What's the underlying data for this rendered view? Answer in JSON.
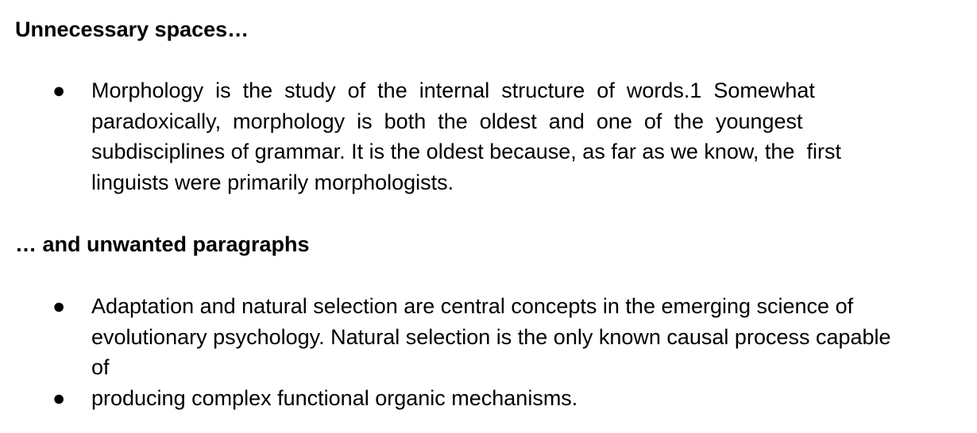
{
  "headings": {
    "spaces": "Unnecessary spaces…",
    "paragraphs": "… and unwanted paragraphs"
  },
  "items": [
    {
      "bullet": "●",
      "lines": [
        "Morphology  is  the  study  of  the  internal  structure  of  words.1  Somewhat",
        "paradoxically,  morphology  is  both  the  oldest  and  one  of  the  youngest",
        "subdisciplines of grammar. It is the oldest because, as far as we know, the  first",
        "linguists were primarily morphologists."
      ]
    },
    {
      "bullet": "●",
      "lines": [
        "Adaptation and natural selection are central concepts in the emerging science of",
        "evolutionary psychology. Natural selection is the only known causal process capable",
        "of"
      ]
    },
    {
      "bullet": "●",
      "lines": [
        "producing complex functional organic mechanisms."
      ]
    }
  ]
}
